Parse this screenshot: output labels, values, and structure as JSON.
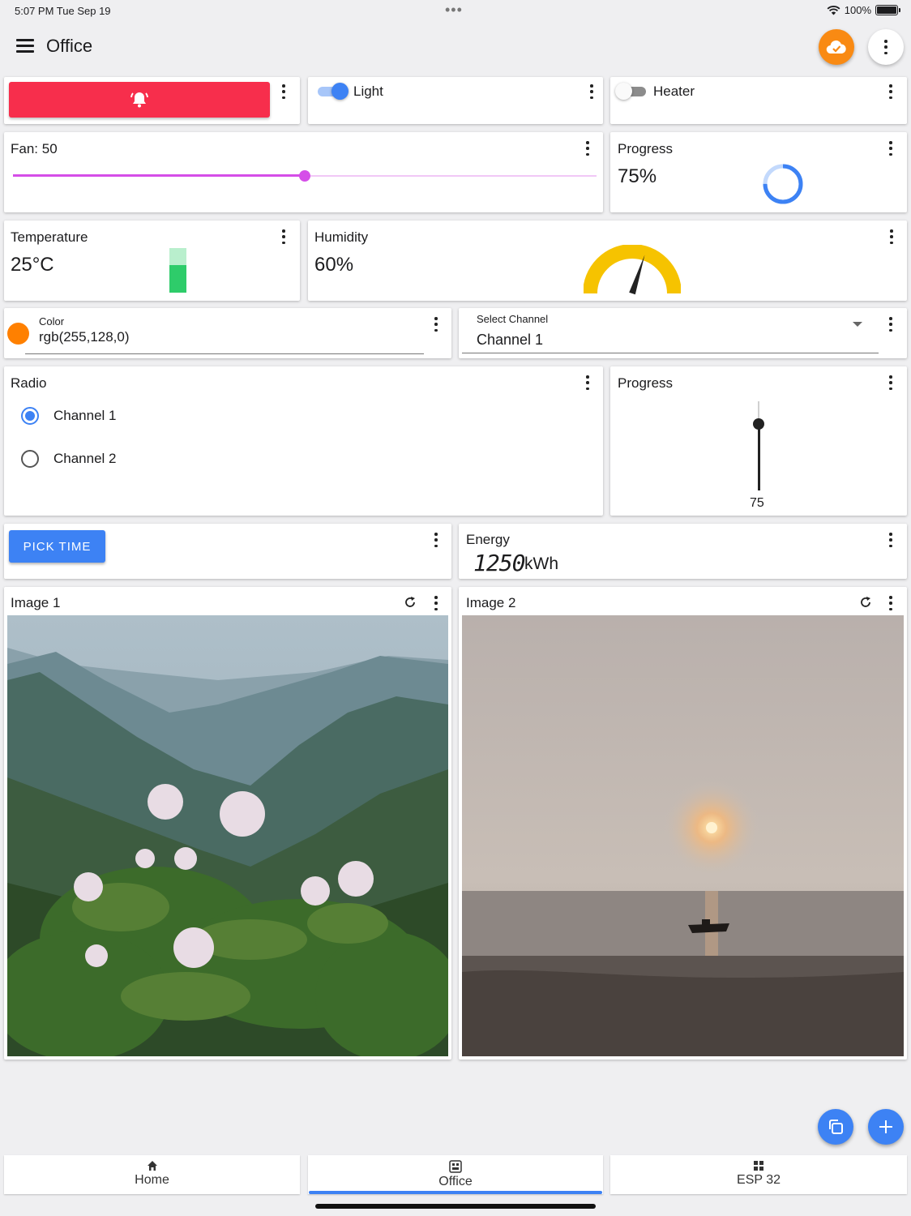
{
  "status_bar": {
    "time": "5:07 PM   Tue Sep 19",
    "dots": "•••",
    "battery": "100%"
  },
  "app_bar": {
    "title": "Office"
  },
  "colors": {
    "alarm": "#f72e4c",
    "accent": "#3d82f4",
    "slider": "#d54ee8",
    "orange": "#f98a13",
    "gauge": "#f6c300",
    "green": "#2ecc6a"
  },
  "widgets": {
    "light": {
      "label": "Light",
      "on": true
    },
    "heater": {
      "label": "Heater",
      "on": false
    },
    "fan": {
      "label": "Fan: 50",
      "value": 50,
      "min": 0,
      "max": 100
    },
    "progress1": {
      "label": "Progress",
      "value": "75%",
      "fraction": 0.75
    },
    "temperature": {
      "label": "Temperature",
      "value": "25°C",
      "level": 0.62
    },
    "humidity": {
      "label": "Humidity",
      "value": "60%",
      "fraction": 0.6
    },
    "color": {
      "caption": "Color",
      "value": "rgb(255,128,0)"
    },
    "select": {
      "caption": "Select Channel",
      "value": "Channel 1"
    },
    "radio": {
      "label": "Radio",
      "options": [
        "Channel 1",
        "Channel 2"
      ],
      "selected": 0
    },
    "progress2": {
      "label": "Progress",
      "value": "75",
      "fraction": 0.75
    },
    "pick_time": {
      "label": "PICK TIME"
    },
    "energy": {
      "label": "Energy",
      "value": "1250",
      "unit": "kWh"
    },
    "image1": {
      "label": "Image 1"
    },
    "image2": {
      "label": "Image 2"
    }
  },
  "bottom_nav": {
    "items": [
      "Home",
      "Office",
      "ESP 32"
    ],
    "active": 1
  }
}
